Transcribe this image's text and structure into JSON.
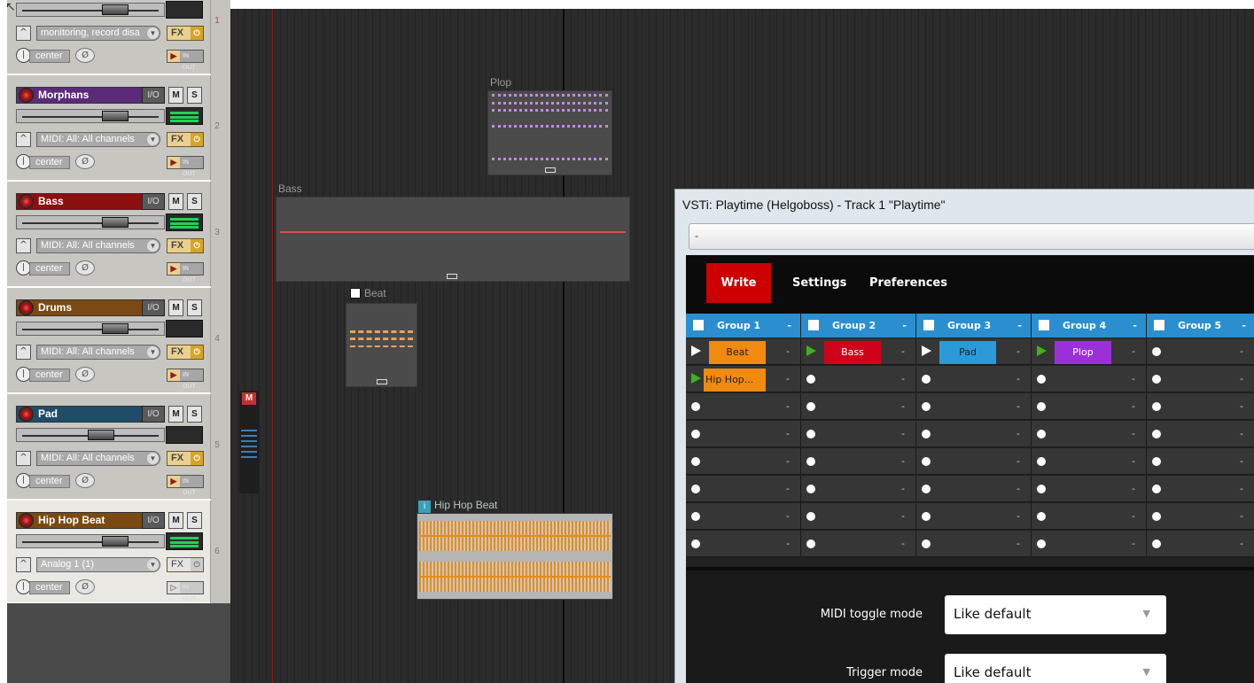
{
  "tracks": [
    {
      "num": "1",
      "name": "",
      "color": "#c7c6c1",
      "input": "monitoring, record disa",
      "pan": "center",
      "partial": true
    },
    {
      "num": "2",
      "name": "Morphans",
      "color": "#5b2b7a",
      "input": "MIDI: All: All channels",
      "pan": "center"
    },
    {
      "num": "3",
      "name": "Bass",
      "color": "#8b1010",
      "input": "MIDI: All: All channels",
      "pan": "center"
    },
    {
      "num": "4",
      "name": "Drums",
      "color": "#7a4a12",
      "input": "MIDI: All: All channels",
      "pan": "center"
    },
    {
      "num": "5",
      "name": "Pad",
      "color": "#1f4d68",
      "input": "MIDI: All: All channels",
      "pan": "center"
    },
    {
      "num": "6",
      "name": "Hip Hop Beat",
      "color": "#7a4a12",
      "input": "Analog 1 (1)",
      "pan": "center"
    }
  ],
  "track_buttons": {
    "io": "I/O",
    "mute": "M",
    "solo": "S",
    "fx": "FX",
    "inout": "IN OUT"
  },
  "master": {
    "label": "M"
  },
  "items": {
    "plop": "Plop",
    "bass": "Bass",
    "beat": "Beat",
    "hiphop": "Hip Hop Beat"
  },
  "vst": {
    "title": "VSTi: Playtime (Helgoboss) - Track 1 \"Playtime\"",
    "preset": "-",
    "menu": {
      "write": "Write",
      "settings": "Settings",
      "preferences": "Preferences"
    },
    "groups": [
      "Group 1",
      "Group 2",
      "Group 3",
      "Group 4",
      "Group 5"
    ],
    "group_dash": "-",
    "clips": {
      "beat": "Beat",
      "bass": "Bass",
      "pad": "Pad",
      "plop": "Plop",
      "hiphop": "Hip Hop..."
    },
    "settings": [
      {
        "label": "MIDI toggle mode",
        "value": "Like default"
      },
      {
        "label": "Trigger mode",
        "value": "Like default"
      }
    ]
  }
}
